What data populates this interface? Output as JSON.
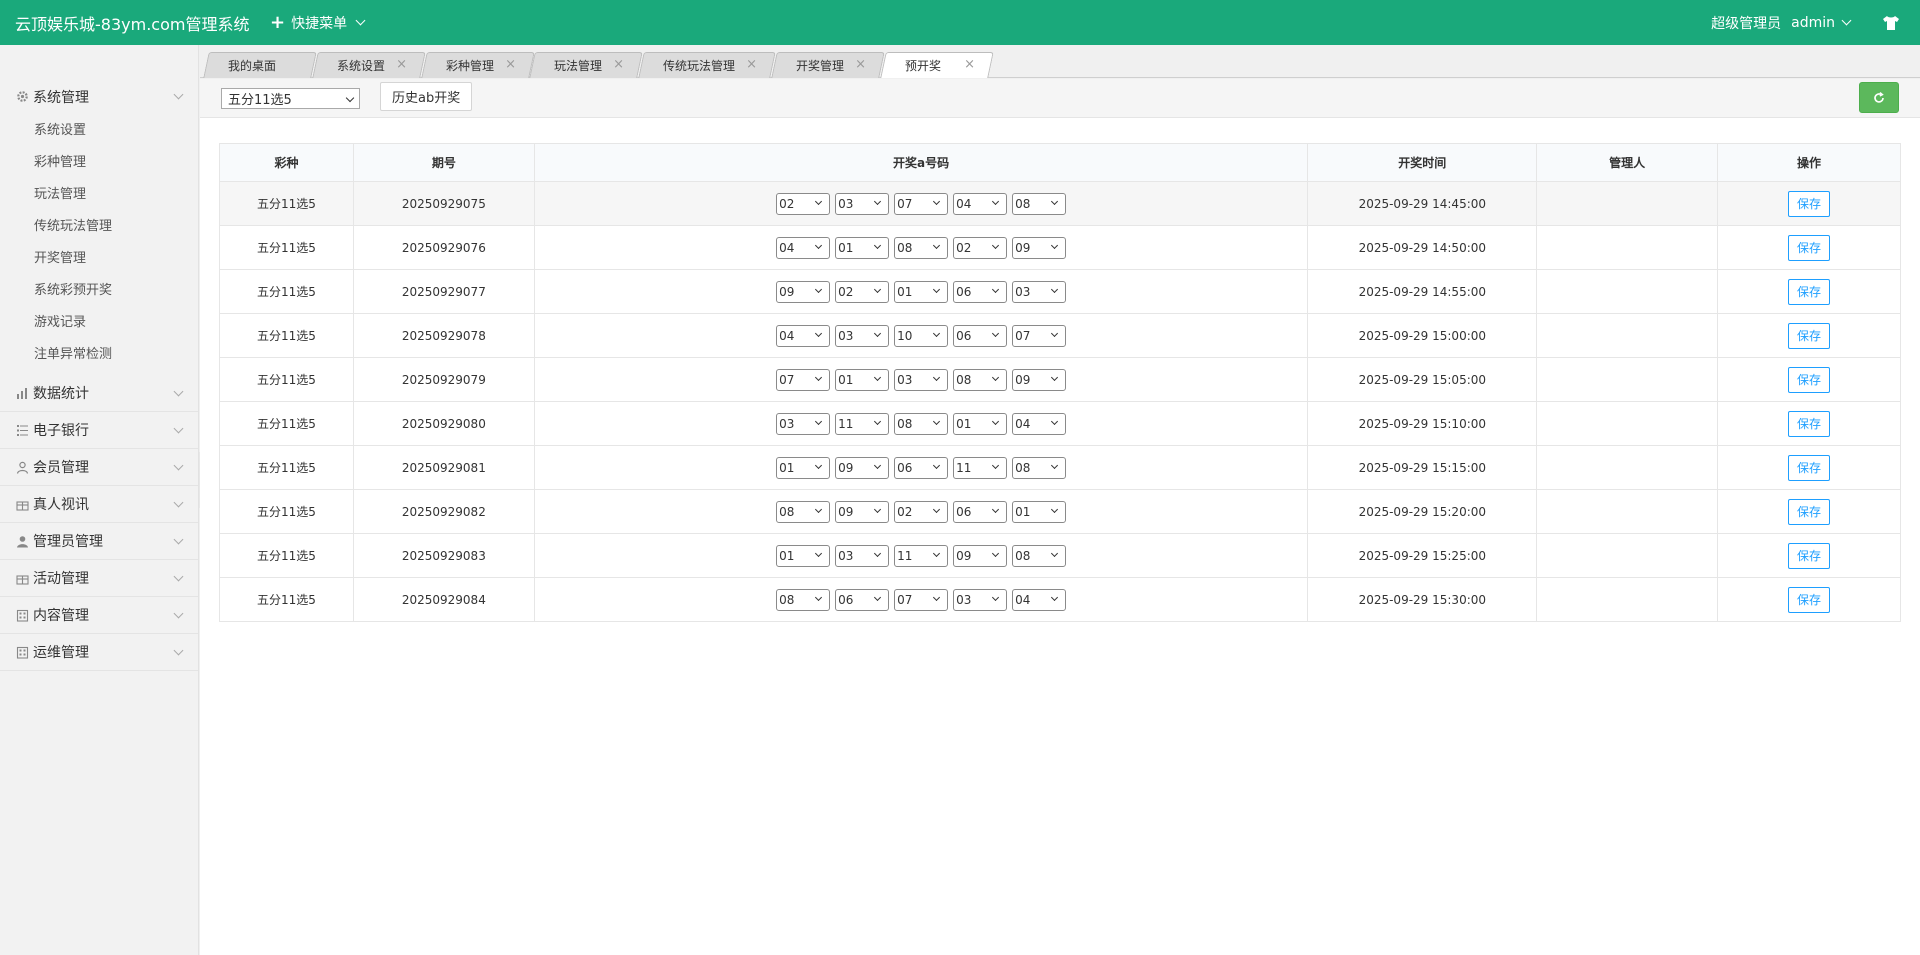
{
  "header": {
    "brand": "云顶娱乐城-83ym.com管理系统",
    "quick_menu_label": "快捷菜单",
    "role": "超级管理员",
    "username": "admin"
  },
  "sidebar": {
    "system_group": "系统管理",
    "system_items": [
      "系统设置",
      "彩种管理",
      "玩法管理",
      "传统玩法管理",
      "开奖管理",
      "系统彩预开奖",
      "游戏记录",
      "注单异常检测"
    ],
    "groups": [
      {
        "label": "数据统计",
        "icon": "bar-chart-icon"
      },
      {
        "label": "电子银行",
        "icon": "list-icon"
      },
      {
        "label": "会员管理",
        "icon": "user-icon"
      },
      {
        "label": "真人视讯",
        "icon": "gift-icon"
      },
      {
        "label": "管理员管理",
        "icon": "admin-user-icon"
      },
      {
        "label": "活动管理",
        "icon": "gift-icon"
      },
      {
        "label": "内容管理",
        "icon": "building-icon"
      },
      {
        "label": "运维管理",
        "icon": "building-icon"
      }
    ]
  },
  "tabs": [
    {
      "label": "我的桌面",
      "closable": false
    },
    {
      "label": "系统设置",
      "closable": true
    },
    {
      "label": "彩种管理",
      "closable": true
    },
    {
      "label": "玩法管理",
      "closable": true
    },
    {
      "label": "传统玩法管理",
      "closable": true
    },
    {
      "label": "开奖管理",
      "closable": true
    },
    {
      "label": "预开奖",
      "closable": true,
      "active": true
    }
  ],
  "toolbar": {
    "lottery_selected": "五分11选5",
    "history_button": "历史ab开奖"
  },
  "table": {
    "headers": [
      "彩种",
      "期号",
      "开奖a号码",
      "开奖时间",
      "管理人",
      "操作"
    ],
    "save_label": "保存",
    "rows": [
      {
        "lottery": "五分11选5",
        "issue": "20250929075",
        "nums": [
          "02",
          "03",
          "07",
          "04",
          "08"
        ],
        "time": "2025-09-29 14:45:00",
        "admin": ""
      },
      {
        "lottery": "五分11选5",
        "issue": "20250929076",
        "nums": [
          "04",
          "01",
          "08",
          "02",
          "09"
        ],
        "time": "2025-09-29 14:50:00",
        "admin": ""
      },
      {
        "lottery": "五分11选5",
        "issue": "20250929077",
        "nums": [
          "09",
          "02",
          "01",
          "06",
          "03"
        ],
        "time": "2025-09-29 14:55:00",
        "admin": ""
      },
      {
        "lottery": "五分11选5",
        "issue": "20250929078",
        "nums": [
          "04",
          "03",
          "10",
          "06",
          "07"
        ],
        "time": "2025-09-29 15:00:00",
        "admin": ""
      },
      {
        "lottery": "五分11选5",
        "issue": "20250929079",
        "nums": [
          "07",
          "01",
          "03",
          "08",
          "09"
        ],
        "time": "2025-09-29 15:05:00",
        "admin": ""
      },
      {
        "lottery": "五分11选5",
        "issue": "20250929080",
        "nums": [
          "03",
          "11",
          "08",
          "01",
          "04"
        ],
        "time": "2025-09-29 15:10:00",
        "admin": ""
      },
      {
        "lottery": "五分11选5",
        "issue": "20250929081",
        "nums": [
          "01",
          "09",
          "06",
          "11",
          "08"
        ],
        "time": "2025-09-29 15:15:00",
        "admin": ""
      },
      {
        "lottery": "五分11选5",
        "issue": "20250929082",
        "nums": [
          "08",
          "09",
          "02",
          "06",
          "01"
        ],
        "time": "2025-09-29 15:20:00",
        "admin": ""
      },
      {
        "lottery": "五分11选5",
        "issue": "20250929083",
        "nums": [
          "01",
          "03",
          "11",
          "09",
          "08"
        ],
        "time": "2025-09-29 15:25:00",
        "admin": ""
      },
      {
        "lottery": "五分11选5",
        "issue": "20250929084",
        "nums": [
          "08",
          "06",
          "07",
          "03",
          "04"
        ],
        "time": "2025-09-29 15:30:00",
        "admin": ""
      }
    ]
  },
  "colors": {
    "header_bg": "#1aa97b",
    "save_btn": "#1e9fff",
    "refresh_btn": "#5cb85c"
  }
}
